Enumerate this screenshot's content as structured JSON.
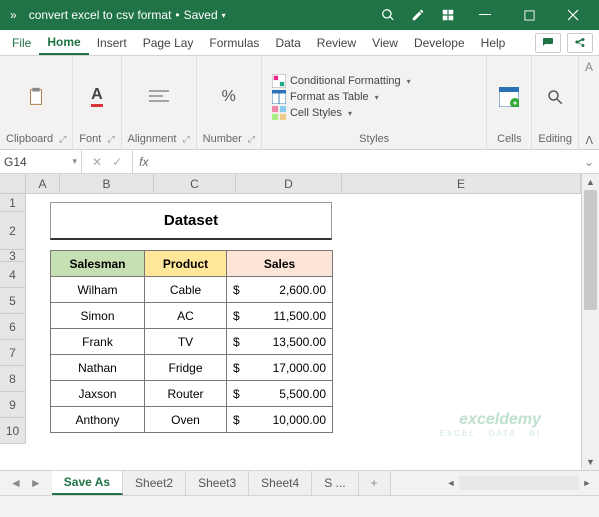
{
  "title": {
    "filename": "convert excel to csv format",
    "save_state": "Saved"
  },
  "ribbon_tabs": {
    "file": "File",
    "home": "Home",
    "insert": "Insert",
    "page_layout": "Page Lay",
    "formulas": "Formulas",
    "data": "Data",
    "review": "Review",
    "view": "View",
    "developer": "Develope",
    "help": "Help"
  },
  "ribbon": {
    "clipboard": "Clipboard",
    "font": "Font",
    "alignment": "Alignment",
    "number": "Number",
    "styles": "Styles",
    "cond_format": "Conditional Formatting",
    "format_table": "Format as Table",
    "cell_styles": "Cell Styles",
    "cells": "Cells",
    "editing": "Editing"
  },
  "namebox": "G14",
  "fx_label": "fx",
  "columns": [
    "A",
    "B",
    "C",
    "D",
    "E"
  ],
  "rows": [
    "1",
    "2",
    "3",
    "4",
    "5",
    "6",
    "7",
    "8",
    "9",
    "10"
  ],
  "dataset": {
    "title": "Dataset",
    "headers": {
      "salesman": "Salesman",
      "product": "Product",
      "sales": "Sales"
    },
    "currency": "$"
  },
  "chart_data": {
    "type": "table",
    "columns": [
      "Salesman",
      "Product",
      "Sales"
    ],
    "rows": [
      {
        "salesman": "Wilham",
        "product": "Cable",
        "sales": 2600.0,
        "sales_fmt": "2,600.00"
      },
      {
        "salesman": "Simon",
        "product": "AC",
        "sales": 11500.0,
        "sales_fmt": "11,500.00"
      },
      {
        "salesman": "Frank",
        "product": "TV",
        "sales": 13500.0,
        "sales_fmt": "13,500.00"
      },
      {
        "salesman": "Nathan",
        "product": "Fridge",
        "sales": 17000.0,
        "sales_fmt": "17,000.00"
      },
      {
        "salesman": "Jaxson",
        "product": "Router",
        "sales": 5500.0,
        "sales_fmt": "5,500.00"
      },
      {
        "salesman": "Anthony",
        "product": "Oven",
        "sales": 10000.0,
        "sales_fmt": "10,000.00"
      }
    ]
  },
  "sheets": {
    "active": "Save As",
    "others": [
      "Sheet2",
      "Sheet3",
      "Sheet4",
      "S ..."
    ],
    "add": "+"
  },
  "watermark": {
    "line1": "exceldemy",
    "line2": "EXCEL · DATA · BI"
  }
}
